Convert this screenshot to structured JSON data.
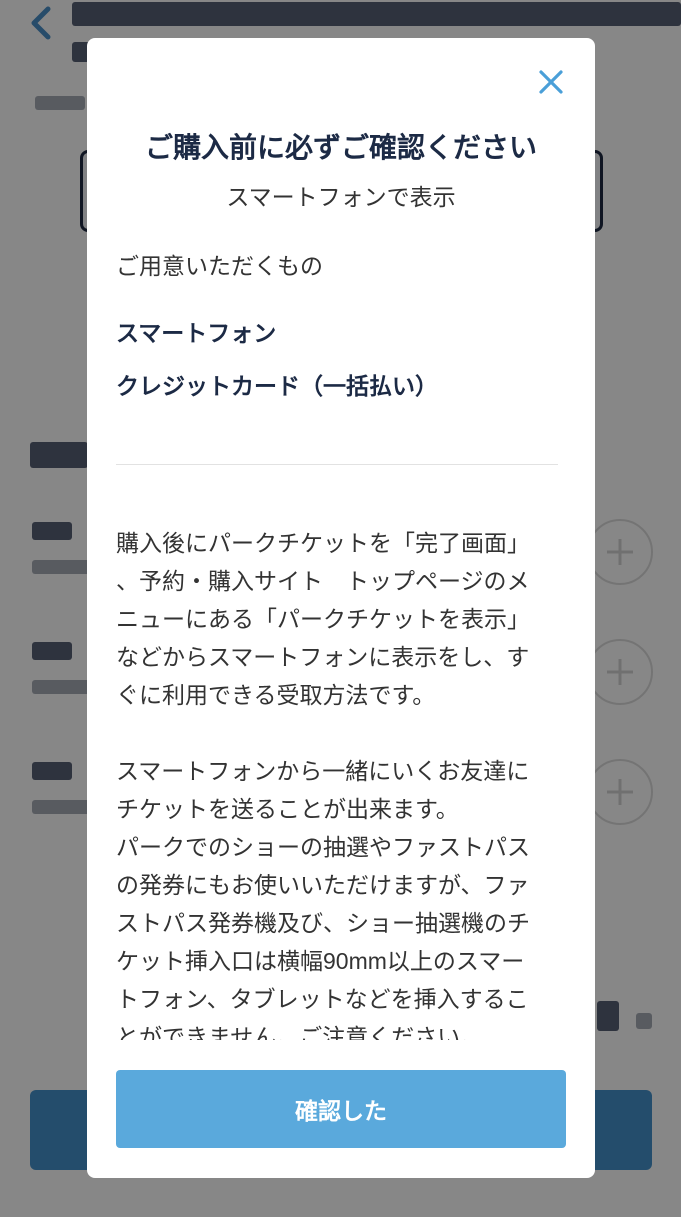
{
  "colors": {
    "accent": "#5aa9dc",
    "title_text": "#1c2a45",
    "body_text": "#333333",
    "background_accent": "#4592cc"
  },
  "background_page": {
    "back_icon": "chevron-left-icon",
    "plus_icon": "plus-circle-icon"
  },
  "modal": {
    "close_icon": "close-icon",
    "title": "ご購入前に必ずご確認ください",
    "subtitle": "スマートフォンで表示",
    "requirements_heading": "ご用意いただくもの",
    "requirements": [
      "スマートフォン",
      "クレジットカード（一括払い）"
    ],
    "paragraphs": [
      [
        "購入後にパークチケットを「完了画面」",
        "、予約・購入サイト　トップページのメ",
        "ニューにある「パークチケットを表示」",
        "などからスマートフォンに表示をし、す",
        "ぐに利用できる受取方法です。"
      ],
      [
        "スマートフォンから一緒にいくお友達に",
        "チケットを送ることが出来ます。",
        "パークでのショーの抽選やファストパス",
        "の発券にもお使いいただけますが、ファ",
        "ストパス発券機及び、ショー抽選機のチ",
        "ケット挿入口は横幅90mm以上のスマー",
        "トフォン、タブレットなどを挿入するこ",
        "とができません。ご注意ください。"
      ]
    ],
    "confirm_button": "確認した"
  }
}
